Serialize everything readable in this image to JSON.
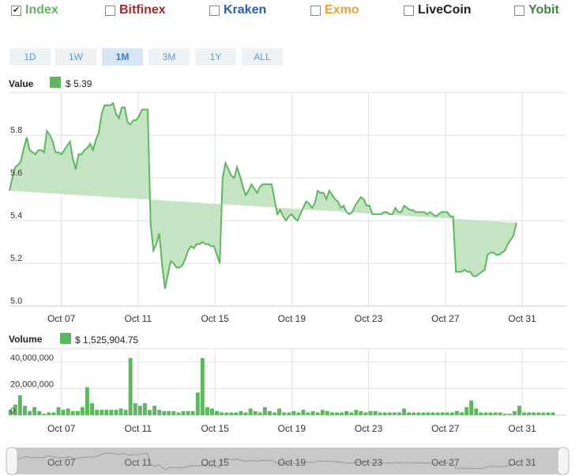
{
  "exchanges": [
    {
      "label": "Index",
      "checked": true,
      "color": "#5cb85c"
    },
    {
      "label": "Bitfinex",
      "checked": false,
      "color": "#a52a2a"
    },
    {
      "label": "Kraken",
      "checked": false,
      "color": "#2a5db0"
    },
    {
      "label": "Exmo",
      "checked": false,
      "color": "#f0a030"
    },
    {
      "label": "LiveCoin",
      "checked": false,
      "color": "#222222"
    },
    {
      "label": "Yobit",
      "checked": false,
      "color": "#3a8a3a"
    }
  ],
  "ranges": [
    "1D",
    "1W",
    "1M",
    "3M",
    "1Y",
    "ALL"
  ],
  "active_range": "1M",
  "value_legend": {
    "label": "Value",
    "text": "$ 5.39"
  },
  "volume_legend": {
    "label": "Volume",
    "text": "$ 1,525,904.75"
  },
  "chart_data": [
    {
      "type": "area",
      "title": "Value",
      "color": "#5cb85c",
      "fill": "#c4e4c4",
      "ylim": [
        5.0,
        6.0
      ],
      "yticks": [
        "5.0",
        "5.2",
        "5.4",
        "5.6",
        "5.8"
      ],
      "ytick_values": [
        5.0,
        5.2,
        5.4,
        5.6,
        5.8
      ],
      "x_range": [
        4.3,
        33.3
      ],
      "xticks": [
        "Oct 07",
        "Oct 11",
        "Oct 15",
        "Oct 19",
        "Oct 23",
        "Oct 27",
        "Oct 31"
      ],
      "xtick_values": [
        7,
        11,
        15,
        19,
        23,
        27,
        31
      ],
      "x": [
        4.3,
        4.45,
        4.6,
        4.75,
        4.9,
        5.05,
        5.2,
        5.35,
        5.5,
        5.65,
        5.8,
        5.95,
        6.1,
        6.25,
        6.4,
        6.55,
        6.7,
        6.85,
        7.0,
        7.15,
        7.3,
        7.45,
        7.6,
        7.75,
        7.9,
        8.05,
        8.2,
        8.35,
        8.5,
        8.65,
        8.8,
        8.95,
        9.1,
        9.25,
        9.4,
        9.55,
        9.7,
        9.85,
        10.0,
        10.15,
        10.3,
        10.45,
        10.6,
        10.75,
        10.9,
        11.05,
        11.2,
        11.35,
        11.5,
        11.65,
        11.8,
        11.95,
        12.1,
        12.25,
        12.4,
        12.55,
        12.7,
        12.85,
        13.0,
        13.15,
        13.3,
        13.45,
        13.6,
        13.75,
        13.9,
        14.05,
        14.2,
        14.35,
        14.5,
        14.65,
        14.8,
        14.95,
        15.1,
        15.25,
        15.4,
        15.55,
        15.7,
        15.85,
        16.0,
        16.15,
        16.3,
        16.45,
        16.6,
        16.75,
        16.9,
        17.05,
        17.2,
        17.35,
        17.5,
        17.65,
        17.8,
        17.95,
        18.1,
        18.25,
        18.4,
        18.55,
        18.7,
        18.85,
        19.0,
        19.15,
        19.3,
        19.45,
        19.6,
        19.75,
        19.9,
        20.05,
        20.2,
        20.35,
        20.5,
        20.65,
        20.8,
        20.95,
        21.1,
        21.25,
        21.4,
        21.55,
        21.7,
        21.85,
        22.0,
        22.15,
        22.3,
        22.45,
        22.6,
        22.75,
        22.9,
        23.05,
        23.2,
        23.35,
        23.5,
        23.65,
        23.8,
        23.95,
        24.1,
        24.25,
        24.4,
        24.55,
        24.7,
        24.85,
        25.0,
        25.15,
        25.3,
        25.45,
        25.6,
        25.75,
        25.9,
        26.05,
        26.2,
        26.35,
        26.5,
        26.65,
        26.8,
        26.95,
        27.1,
        27.25,
        27.4,
        27.55,
        27.7,
        27.85,
        28.0,
        28.15,
        28.3,
        28.45,
        28.6,
        28.75,
        28.9,
        29.05,
        29.2,
        29.35,
        29.5,
        29.65,
        29.8,
        29.95,
        30.1,
        30.25,
        30.4,
        30.55,
        30.7,
        30.85,
        31.0,
        31.15,
        31.3,
        31.45,
        31.6,
        31.75,
        31.9,
        32.05,
        32.2,
        32.35,
        32.5,
        32.65,
        32.8,
        32.95,
        33.1,
        33.25,
        33.4
      ],
      "values": [
        5.54,
        5.6,
        5.65,
        5.66,
        5.68,
        5.74,
        5.79,
        5.73,
        5.72,
        5.71,
        5.73,
        5.73,
        5.72,
        5.82,
        5.8,
        5.77,
        5.72,
        5.72,
        5.71,
        5.73,
        5.75,
        5.77,
        5.69,
        5.64,
        5.71,
        5.71,
        5.73,
        5.74,
        5.76,
        5.73,
        5.78,
        5.81,
        5.9,
        5.94,
        5.94,
        5.94,
        5.95,
        5.9,
        5.88,
        5.93,
        5.93,
        5.86,
        5.85,
        5.87,
        5.87,
        5.89,
        5.92,
        5.92,
        5.92,
        5.38,
        5.26,
        5.29,
        5.34,
        5.19,
        5.08,
        5.15,
        5.21,
        5.2,
        5.18,
        5.18,
        5.19,
        5.22,
        5.26,
        5.28,
        5.27,
        5.29,
        5.29,
        5.3,
        5.29,
        5.29,
        5.28,
        5.28,
        5.24,
        5.2,
        5.6,
        5.67,
        5.64,
        5.61,
        5.6,
        5.65,
        5.61,
        5.56,
        5.52,
        5.54,
        5.57,
        5.55,
        5.53,
        5.56,
        5.57,
        5.57,
        5.57,
        5.57,
        5.5,
        5.43,
        5.45,
        5.42,
        5.4,
        5.42,
        5.43,
        5.41,
        5.4,
        5.43,
        5.46,
        5.49,
        5.48,
        5.46,
        5.48,
        5.54,
        5.53,
        5.53,
        5.5,
        5.54,
        5.52,
        5.5,
        5.49,
        5.46,
        5.47,
        5.44,
        5.43,
        5.44,
        5.47,
        5.49,
        5.51,
        5.5,
        5.47,
        5.47,
        5.43,
        5.43,
        5.43,
        5.43,
        5.44,
        5.44,
        5.43,
        5.43,
        5.46,
        5.44,
        5.44,
        5.47,
        5.46,
        5.45,
        5.45,
        5.44,
        5.44,
        5.44,
        5.44,
        5.43,
        5.44,
        5.43,
        5.42,
        5.43,
        5.44,
        5.44,
        5.44,
        5.42,
        5.42,
        5.16,
        5.16,
        5.16,
        5.17,
        5.16,
        5.16,
        5.14,
        5.14,
        5.15,
        5.16,
        5.17,
        5.24,
        5.25,
        5.25,
        5.24,
        5.24,
        5.25,
        5.26,
        5.29,
        5.31,
        5.33,
        5.39
      ]
    },
    {
      "type": "bar",
      "title": "Volume",
      "color": "#5cb85c",
      "ylim": [
        0,
        50000000
      ],
      "yticks": [
        "0",
        "20,000,000",
        "40,000,000"
      ],
      "ytick_values": [
        0,
        20000000,
        40000000
      ],
      "x_range": [
        4.3,
        33.3
      ],
      "xticks": [
        "Oct 07",
        "Oct 11",
        "Oct 15",
        "Oct 19",
        "Oct 23",
        "Oct 27",
        "Oct 31"
      ],
      "xtick_values": [
        7,
        11,
        15,
        19,
        23,
        27,
        31
      ],
      "x": [
        4.35,
        4.6,
        4.85,
        5.1,
        5.35,
        5.6,
        5.85,
        6.1,
        6.35,
        6.6,
        6.85,
        7.1,
        7.35,
        7.6,
        7.85,
        8.1,
        8.35,
        8.6,
        8.85,
        9.1,
        9.35,
        9.6,
        9.85,
        10.1,
        10.35,
        10.6,
        10.85,
        11.1,
        11.35,
        11.6,
        11.85,
        12.1,
        12.35,
        12.6,
        12.85,
        13.1,
        13.35,
        13.6,
        13.85,
        14.1,
        14.35,
        14.6,
        14.85,
        15.1,
        15.35,
        15.6,
        15.85,
        16.1,
        16.35,
        16.6,
        16.85,
        17.1,
        17.35,
        17.6,
        17.85,
        18.1,
        18.35,
        18.6,
        18.85,
        19.1,
        19.35,
        19.6,
        19.85,
        20.1,
        20.35,
        20.6,
        20.85,
        21.1,
        21.35,
        21.6,
        21.85,
        22.1,
        22.35,
        22.6,
        22.85,
        23.1,
        23.35,
        23.6,
        23.85,
        24.1,
        24.35,
        24.6,
        24.85,
        25.1,
        25.35,
        25.6,
        25.85,
        26.1,
        26.35,
        26.6,
        26.85,
        27.1,
        27.35,
        27.6,
        27.85,
        28.1,
        28.35,
        28.6,
        28.85,
        29.1,
        29.35,
        29.6,
        29.85,
        30.1,
        30.35,
        30.6,
        30.85,
        31.1,
        31.35,
        31.6,
        31.85,
        32.1,
        32.35,
        32.6,
        32.85,
        33.1
      ],
      "values": [
        4000000,
        8000000,
        15000000,
        7000000,
        3000000,
        6000000,
        3000000,
        1000000,
        2000000,
        2000000,
        6000000,
        4000000,
        5000000,
        3000000,
        3000000,
        6000000,
        21000000,
        9000000,
        4000000,
        4000000,
        4000000,
        4000000,
        4000000,
        5000000,
        4000000,
        43000000,
        9000000,
        7000000,
        9000000,
        4000000,
        7000000,
        4000000,
        3000000,
        3000000,
        3000000,
        2000000,
        3000000,
        3000000,
        3000000,
        17000000,
        43000000,
        6000000,
        5000000,
        3000000,
        2000000,
        2000000,
        2000000,
        2000000,
        3000000,
        2000000,
        5000000,
        3000000,
        2000000,
        6000000,
        3000000,
        2000000,
        5000000,
        2000000,
        2000000,
        3000000,
        2000000,
        4000000,
        2000000,
        3000000,
        2000000,
        4000000,
        3000000,
        2000000,
        2000000,
        2000000,
        3000000,
        2000000,
        4000000,
        3000000,
        2000000,
        3000000,
        3000000,
        2000000,
        2000000,
        2000000,
        2000000,
        2000000,
        5000000,
        2000000,
        2000000,
        2000000,
        2000000,
        2000000,
        2000000,
        2000000,
        2000000,
        2000000,
        2000000,
        3000000,
        2000000,
        6000000,
        11000000,
        5000000,
        2000000,
        2000000,
        2000000,
        2000000,
        2000000,
        1000000,
        1000000,
        3000000,
        7000000,
        2000000,
        2000000,
        2000000,
        2000000,
        2000000,
        2000000,
        2000000
      ]
    }
  ],
  "navigator": {
    "xticks": [
      "Oct 07",
      "Oct 11",
      "Oct 15",
      "Oct 19",
      "Oct 23",
      "Oct 27",
      "Oct 31"
    ]
  }
}
